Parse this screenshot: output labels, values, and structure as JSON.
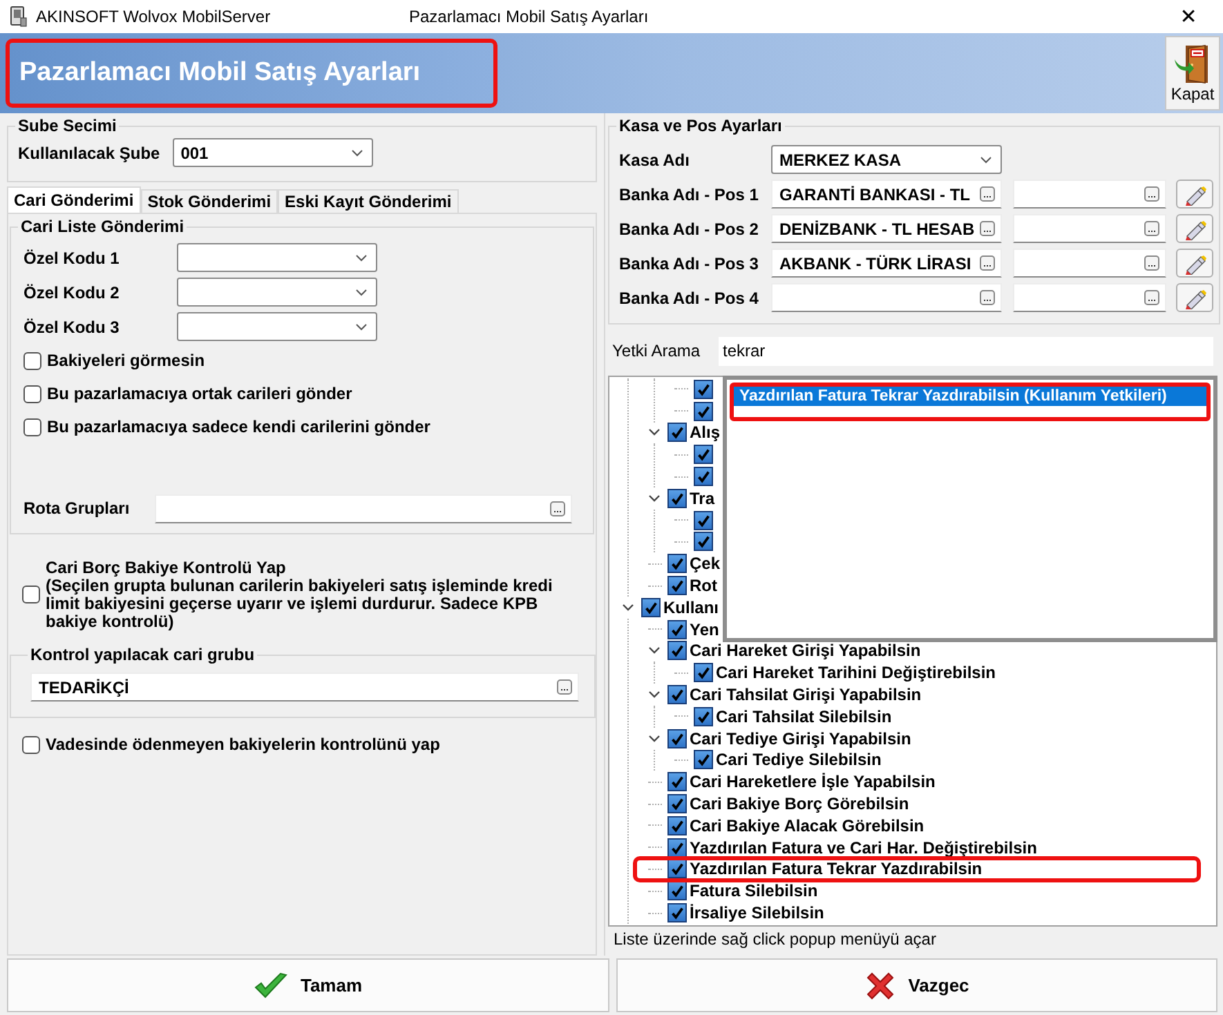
{
  "window": {
    "title": "AKINSOFT Wolvox MobilServer",
    "caption": "Pazarlamacı Mobil Satış Ayarları",
    "close": "✕"
  },
  "header": {
    "title": "Pazarlamacı Mobil Satış Ayarları",
    "highlighted": true,
    "exit_label": "Kapat"
  },
  "branch": {
    "legend": "Sube Secimi",
    "label": "Kullanılacak Şube",
    "value": "001"
  },
  "tabs": [
    {
      "label": "Cari Gönderimi",
      "selected": true
    },
    {
      "label": "Stok Gönderimi",
      "selected": false
    },
    {
      "label": "Eski Kayıt Gönderimi",
      "selected": false
    }
  ],
  "cari_list": {
    "legend": "Cari Liste Gönderimi",
    "special_codes": [
      {
        "label": "Özel Kodu 1"
      },
      {
        "label": "Özel Kodu 2"
      },
      {
        "label": "Özel Kodu 3"
      }
    ],
    "options": [
      {
        "label": "Bakiyeleri görmesin",
        "checked": false
      },
      {
        "label": "Bu pazarlamacıya ortak carileri gönder",
        "checked": false
      },
      {
        "label": "Bu pazarlamacıya sadece kendi carilerini gönder",
        "checked": false
      }
    ],
    "route_label": "Rota Grupları"
  },
  "balance_check": {
    "title": "Cari Borç Bakiye Kontrolü Yap",
    "note": "(Seçilen grupta bulunan carilerin bakiyeleri satış işleminde kredi limit bakiyesini geçerse uyarır ve işlemi durdurur. Sadece KPB bakiye kontrolü)",
    "checked": false
  },
  "control_group": {
    "legend": "Kontrol yapılacak cari grubu",
    "value": "TEDARİKÇİ"
  },
  "overdue_check": {
    "label": "Vadesinde ödenmeyen bakiyelerin kontrolünü yap",
    "checked": false
  },
  "cash_pos": {
    "legend": "Kasa ve Pos Ayarları",
    "cash_label": "Kasa Adı",
    "cash_value": "MERKEZ KASA",
    "pos": [
      {
        "label": "Banka Adı - Pos 1",
        "bank": "GARANTİ BANKASI - TL"
      },
      {
        "label": "Banka Adı - Pos 2",
        "bank": "DENİZBANK - TL HESAB"
      },
      {
        "label": "Banka Adı - Pos 3",
        "bank": "AKBANK - TÜRK LİRASI"
      },
      {
        "label": "Banka Adı - Pos 4"
      }
    ]
  },
  "permission_search": {
    "label": "Yetki Arama",
    "value": "tekrar"
  },
  "permission_tree": [
    {
      "children": [
        {
          "children": [
            {
              "checked": true
            },
            {
              "checked": true
            }
          ]
        },
        {
          "label": "Alış",
          "checked": true,
          "expanded": true,
          "children": [
            {
              "checked": true
            },
            {
              "checked": true
            }
          ]
        },
        {
          "label": "Tra",
          "checked": true,
          "expanded": true,
          "children": [
            {
              "checked": true
            },
            {
              "checked": true
            }
          ]
        },
        {
          "label": "Çek",
          "checked": true
        },
        {
          "label": "Rot",
          "checked": true
        }
      ]
    },
    {
      "label": "Kullanı",
      "checked": true,
      "expanded": true,
      "children": [
        {
          "label": "Yen",
          "checked": true
        },
        {
          "label": "Cari Hareket Girişi Yapabilsin",
          "checked": true,
          "expanded": true,
          "children": [
            {
              "label": "Cari Hareket Tarihini Değiştirebilsin",
              "checked": true
            }
          ]
        },
        {
          "label": "Cari Tahsilat Girişi Yapabilsin",
          "checked": true,
          "expanded": true,
          "children": [
            {
              "label": "Cari Tahsilat Silebilsin",
              "checked": true
            }
          ]
        },
        {
          "label": "Cari Tediye Girişi Yapabilsin",
          "checked": true,
          "expanded": true,
          "children": [
            {
              "label": "Cari Tediye Silebilsin",
              "checked": true
            }
          ]
        },
        {
          "label": "Cari Hareketlere İşle Yapabilsin",
          "checked": true
        },
        {
          "label": "Cari Bakiye Borç Görebilsin",
          "checked": true
        },
        {
          "label": "Cari Bakiye Alacak Görebilsin",
          "checked": true
        },
        {
          "label": "Yazdırılan Fatura ve Cari Har. Değiştirebilsin",
          "checked": true
        },
        {
          "label": "Yazdırılan Fatura Tekrar Yazdırabilsin",
          "checked": true,
          "highlighted": true
        },
        {
          "label": "Fatura Silebilsin",
          "checked": true
        },
        {
          "label": "İrsaliye Silebilsin",
          "checked": true
        }
      ]
    }
  ],
  "search_popup": {
    "results": [
      {
        "label": "Yazdırılan Fatura Tekrar Yazdırabilsin (Kullanım Yetkileri)",
        "selected": true,
        "highlighted": true
      }
    ]
  },
  "status_bar": "Liste üzerinde sağ click popup menüyü açar",
  "buttons": [
    {
      "kind": "ok",
      "label": "Tamam"
    },
    {
      "kind": "cancel",
      "label": "Vazgec"
    }
  ]
}
